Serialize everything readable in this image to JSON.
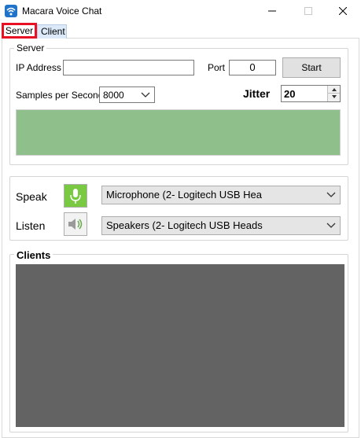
{
  "window": {
    "title": "Macara Voice Chat",
    "icon": "wifi-icon",
    "controls": [
      "minimize-icon",
      "maximize-icon",
      "close-icon"
    ]
  },
  "tabs": [
    {
      "label": "Server",
      "selected": true,
      "highlighted": true
    },
    {
      "label": "Client",
      "selected": false
    }
  ],
  "server_group": {
    "legend": "Server",
    "ip_label": "IP Address",
    "ip_value": "",
    "port_label": "Port",
    "port_value": "0",
    "start_label": "Start",
    "samples_label": "Samples per Second",
    "samples_value": "8000",
    "jitter_label": "Jitter",
    "jitter_value": "20",
    "status_color": "#8fbf8a"
  },
  "audio_group": {
    "speak_label": "Speak",
    "speak_icon": "microphone-icon",
    "speak_device": "Microphone (2- Logitech USB Hea",
    "listen_label": "Listen",
    "listen_icon": "speaker-icon",
    "listen_device": "Speakers (2- Logitech USB Heads"
  },
  "clients_group": {
    "legend": "Clients",
    "list_color": "#636363"
  },
  "colors": {
    "highlight": "#e81123",
    "icon_button_green": "#7ac943"
  }
}
